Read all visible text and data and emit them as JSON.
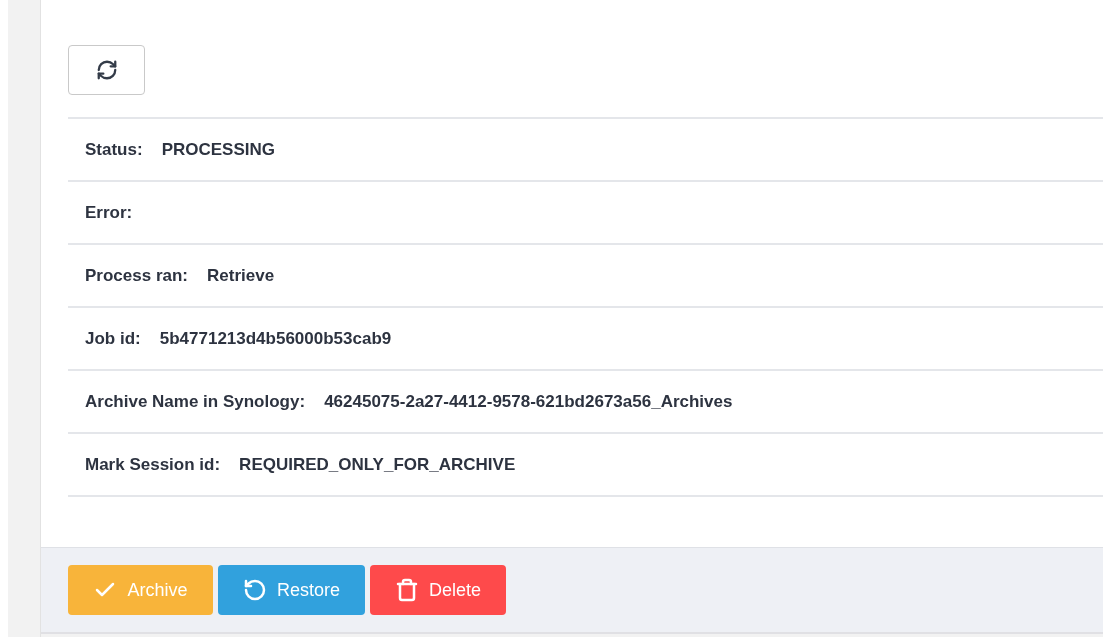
{
  "fields": [
    {
      "label": "Status:",
      "value": "PROCESSING"
    },
    {
      "label": "Error:"
    },
    {
      "label": "Process ran:",
      "value": "Retrieve"
    },
    {
      "label": "Job id:",
      "value": "5b4771213d4b56000b53cab9"
    },
    {
      "label": "Archive Name in Synology:",
      "value": "46245075-2a27-4412-9578-621bd2673a56_Archives"
    },
    {
      "label": "Mark Session id:",
      "value": "REQUIRED_ONLY_FOR_ARCHIVE"
    }
  ],
  "actions": [
    {
      "kind": "archive",
      "label": "Archive"
    },
    {
      "kind": "restore",
      "label": "Restore"
    },
    {
      "kind": "delete",
      "label": "Delete"
    }
  ]
}
